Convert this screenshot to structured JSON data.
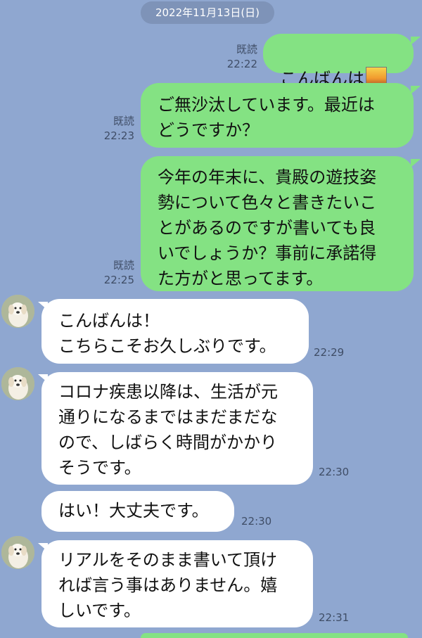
{
  "date_pill": "2022年11月13日(日)",
  "colors": {
    "background": "#8fa7d0",
    "sent_bubble": "#84e283",
    "received_bubble": "#ffffff"
  },
  "messages": [
    {
      "side": "sent",
      "read": "既読",
      "time": "22:22",
      "text": "こんばんは",
      "emoji": "sunset-cityscape-icon"
    },
    {
      "side": "sent",
      "read": "既読",
      "time": "22:23",
      "text": "ご無沙汰しています。最近は\nどうですか？"
    },
    {
      "side": "sent",
      "read": "既読",
      "time": "22:25",
      "text": "今年の年末に、貴殿の遊技姿\n勢について色々と書きたいこ\nとがあるのですが書いても良\nいでしょうか？事前に承諾得\nた方がと思ってます。"
    },
    {
      "side": "received",
      "time": "22:29",
      "text": "こんばんは！\nこちらこそお久しぶりです。"
    },
    {
      "side": "received",
      "time": "22:30",
      "text": "コロナ疾患以降は、生活が元\n通りになるまではまだまだな\nので、しばらく時間がかかり\nそうです。"
    },
    {
      "side": "received",
      "time": "22:30",
      "text": "はい！大丈夫です。"
    },
    {
      "side": "received",
      "time": "22:31",
      "text": "リアルをそのまま書いて頂け\nれば言う事はありません。嬉\nしいです。"
    }
  ]
}
